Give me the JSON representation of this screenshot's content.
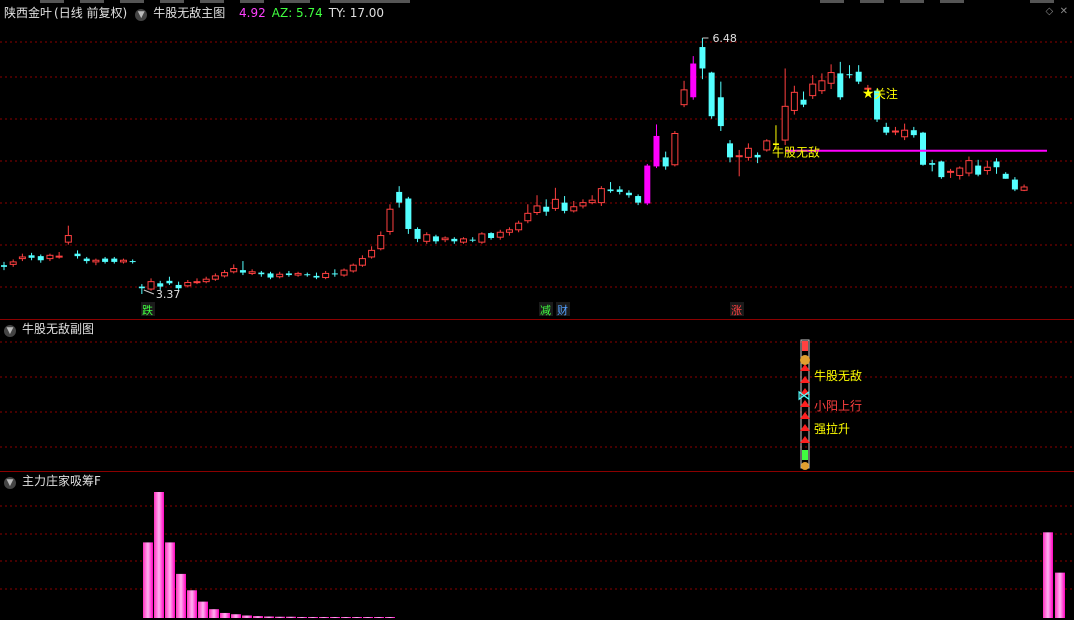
{
  "main_header": {
    "stock": "陕西金叶",
    "period": "(日线 前复权)",
    "indicator": "牛股无敌主图",
    "v1": "4.92",
    "v2": "AZ: 5.74",
    "v3": "TY: 17.00"
  },
  "sub_header": {
    "title": "牛股无敌副图"
  },
  "vol_header": {
    "title": "主力庄家吸筹F"
  },
  "annotations": {
    "high": "6.48",
    "low": "3.37",
    "guanzhu": "关注",
    "niugu": "牛股无敌",
    "die": "跌",
    "jian": "减",
    "cai": "财",
    "zhang": "涨",
    "sub_niugu": "牛股无敌",
    "sub_xiaoyang": "小阳上行",
    "sub_qiangla": "强拉升"
  },
  "colors": {
    "up": "#ff4040",
    "down": "#54ffff",
    "magenta": "#ff00ff",
    "yellow": "#ffff00",
    "grid": "#8b0000"
  },
  "chart_data": {
    "type": "candlestick",
    "candles": [
      [
        3.72,
        3.7,
        3.76,
        3.66
      ],
      [
        3.73,
        3.76,
        3.79,
        3.7
      ],
      [
        3.8,
        3.82,
        3.86,
        3.77
      ],
      [
        3.84,
        3.81,
        3.87,
        3.78
      ],
      [
        3.83,
        3.78,
        3.85,
        3.75
      ],
      [
        3.8,
        3.84,
        3.86,
        3.77
      ],
      [
        3.83,
        3.83,
        3.88,
        3.8
      ],
      [
        4.0,
        4.08,
        4.2,
        3.97
      ],
      [
        3.86,
        3.83,
        3.9,
        3.8
      ],
      [
        3.8,
        3.77,
        3.82,
        3.74
      ],
      [
        3.76,
        3.78,
        3.8,
        3.72
      ],
      [
        3.8,
        3.76,
        3.82,
        3.74
      ],
      [
        3.8,
        3.76,
        3.82,
        3.74
      ],
      [
        3.76,
        3.78,
        3.8,
        3.74
      ],
      [
        3.77,
        3.76,
        3.79,
        3.74
      ],
      [
        3.46,
        3.44,
        3.49,
        3.37
      ],
      [
        3.43,
        3.52,
        3.56,
        3.41
      ],
      [
        3.5,
        3.46,
        3.53,
        3.42
      ],
      [
        3.53,
        3.5,
        3.58,
        3.48
      ],
      [
        3.48,
        3.44,
        3.52,
        3.42
      ],
      [
        3.47,
        3.51,
        3.54,
        3.45
      ],
      [
        3.51,
        3.52,
        3.56,
        3.49
      ],
      [
        3.52,
        3.55,
        3.58,
        3.5
      ],
      [
        3.55,
        3.59,
        3.62,
        3.53
      ],
      [
        3.59,
        3.63,
        3.66,
        3.57
      ],
      [
        3.64,
        3.68,
        3.73,
        3.62
      ],
      [
        3.66,
        3.63,
        3.77,
        3.6
      ],
      [
        3.62,
        3.64,
        3.67,
        3.6
      ],
      [
        3.63,
        3.61,
        3.65,
        3.58
      ],
      [
        3.62,
        3.57,
        3.64,
        3.55
      ],
      [
        3.58,
        3.61,
        3.64,
        3.56
      ],
      [
        3.62,
        3.6,
        3.65,
        3.58
      ],
      [
        3.6,
        3.62,
        3.64,
        3.58
      ],
      [
        3.61,
        3.6,
        3.63,
        3.58
      ],
      [
        3.59,
        3.57,
        3.63,
        3.55
      ],
      [
        3.57,
        3.62,
        3.65,
        3.55
      ],
      [
        3.62,
        3.61,
        3.67,
        3.58
      ],
      [
        3.6,
        3.66,
        3.68,
        3.58
      ],
      [
        3.65,
        3.72,
        3.74,
        3.63
      ],
      [
        3.72,
        3.8,
        3.84,
        3.7
      ],
      [
        3.82,
        3.9,
        3.95,
        3.8
      ],
      [
        3.92,
        4.08,
        4.13,
        3.9
      ],
      [
        4.13,
        4.4,
        4.46,
        4.09
      ],
      [
        4.61,
        4.48,
        4.68,
        4.42
      ],
      [
        4.53,
        4.16,
        4.55,
        4.1
      ],
      [
        4.16,
        4.04,
        4.18,
        4.0
      ],
      [
        4.01,
        4.09,
        4.12,
        3.98
      ],
      [
        4.07,
        4.01,
        4.09,
        3.98
      ],
      [
        4.03,
        4.05,
        4.07,
        4.0
      ],
      [
        4.04,
        4.01,
        4.06,
        3.98
      ],
      [
        4.0,
        4.04,
        4.06,
        3.98
      ],
      [
        4.03,
        4.02,
        4.06,
        4.0
      ],
      [
        4.0,
        4.1,
        4.12,
        3.98
      ],
      [
        4.11,
        4.05,
        4.12,
        4.03
      ],
      [
        4.06,
        4.12,
        4.15,
        4.03
      ],
      [
        4.12,
        4.15,
        4.18,
        4.08
      ],
      [
        4.15,
        4.23,
        4.26,
        4.12
      ],
      [
        4.26,
        4.35,
        4.46,
        4.23
      ],
      [
        4.36,
        4.44,
        4.57,
        4.33
      ],
      [
        4.43,
        4.37,
        4.52,
        4.32
      ],
      [
        4.41,
        4.52,
        4.66,
        4.38
      ],
      [
        4.48,
        4.38,
        4.56,
        4.35
      ],
      [
        4.38,
        4.43,
        4.5,
        4.36
      ],
      [
        4.44,
        4.48,
        4.52,
        4.41
      ],
      [
        4.48,
        4.51,
        4.57,
        4.46
      ],
      [
        4.48,
        4.65,
        4.68,
        4.44
      ],
      [
        4.64,
        4.62,
        4.73,
        4.6
      ],
      [
        4.64,
        4.61,
        4.68,
        4.58
      ],
      [
        4.6,
        4.57,
        4.63,
        4.54
      ],
      [
        4.56,
        4.48,
        4.58,
        4.45
      ],
      [
        4.47,
        4.93,
        4.95,
        4.45
      ],
      [
        4.92,
        5.29,
        5.43,
        4.9
      ],
      [
        5.03,
        4.92,
        5.1,
        4.88
      ],
      [
        4.94,
        5.32,
        5.35,
        4.92
      ],
      [
        5.67,
        5.85,
        5.96,
        5.64
      ],
      [
        5.76,
        6.17,
        6.26,
        5.73
      ],
      [
        6.37,
        6.11,
        6.48,
        5.98
      ],
      [
        6.06,
        5.53,
        6.07,
        5.5
      ],
      [
        5.76,
        5.41,
        5.95,
        5.35
      ],
      [
        5.2,
        5.03,
        5.24,
        4.97
      ],
      [
        5.05,
        5.05,
        5.12,
        4.8
      ],
      [
        5.03,
        5.14,
        5.2,
        4.99
      ],
      [
        5.06,
        5.03,
        5.09,
        4.96
      ],
      [
        5.12,
        5.23,
        5.25,
        5.1
      ],
      [
        5.18,
        5.2,
        5.42,
        5.14
      ],
      [
        5.24,
        5.65,
        6.11,
        5.18
      ],
      [
        5.6,
        5.82,
        5.9,
        5.55
      ],
      [
        5.73,
        5.67,
        5.83,
        5.64
      ],
      [
        5.78,
        5.92,
        6.03,
        5.74
      ],
      [
        5.84,
        5.96,
        6.05,
        5.8
      ],
      [
        5.93,
        6.06,
        6.16,
        5.86
      ],
      [
        6.05,
        5.76,
        6.19,
        5.73
      ],
      [
        6.04,
        6.03,
        6.15,
        5.99
      ],
      [
        6.07,
        5.95,
        6.15,
        5.92
      ],
      [
        5.87,
        5.87,
        5.91,
        5.85
      ],
      [
        5.84,
        5.49,
        5.86,
        5.46
      ],
      [
        5.4,
        5.33,
        5.45,
        5.3
      ],
      [
        5.35,
        5.35,
        5.4,
        5.3
      ],
      [
        5.28,
        5.36,
        5.44,
        5.24
      ],
      [
        5.36,
        5.3,
        5.4,
        5.27
      ],
      [
        5.33,
        4.94,
        5.34,
        4.93
      ],
      [
        4.96,
        4.94,
        5.0,
        4.86
      ],
      [
        4.98,
        4.79,
        4.99,
        4.77
      ],
      [
        4.86,
        4.86,
        4.89,
        4.78
      ],
      [
        4.81,
        4.9,
        4.92,
        4.76
      ],
      [
        4.84,
        4.99,
        5.04,
        4.8
      ],
      [
        4.93,
        4.82,
        5.0,
        4.8
      ],
      [
        4.87,
        4.91,
        4.99,
        4.82
      ],
      [
        4.98,
        4.91,
        5.02,
        4.83
      ],
      [
        4.83,
        4.77,
        4.85,
        4.77
      ],
      [
        4.76,
        4.64,
        4.79,
        4.62
      ],
      [
        4.63,
        4.67,
        4.7,
        4.62
      ]
    ],
    "niugu_line": 5.11,
    "sub_signal_index": 98,
    "volume": [
      0,
      0,
      0,
      0,
      0,
      0,
      0,
      0,
      0,
      0,
      0,
      0,
      0,
      0,
      0,
      0.6,
      1.0,
      0.6,
      0.35,
      0.22,
      0.13,
      0.07,
      0.04,
      0.03,
      0.02,
      0.015,
      0.012,
      0.01,
      0.01,
      0.008,
      0.008,
      0.006,
      0.006,
      0.005,
      0.005,
      0.004,
      0.004,
      0.003,
      0,
      0,
      0,
      0,
      0,
      0,
      0,
      0,
      0,
      0,
      0,
      0,
      0,
      0,
      0,
      0,
      0,
      0,
      0,
      0,
      0,
      0,
      0,
      0,
      0,
      0,
      0,
      0,
      0,
      0,
      0,
      0,
      0,
      0,
      0,
      0,
      0,
      0,
      0,
      0,
      0,
      0,
      0,
      0,
      0,
      0,
      0,
      0,
      0,
      0,
      0,
      0,
      0,
      0,
      0,
      0,
      0,
      0,
      0,
      0,
      0,
      0,
      0,
      0,
      0,
      0,
      0,
      0,
      0,
      0,
      0,
      0,
      0,
      0.68,
      0.36
    ]
  }
}
